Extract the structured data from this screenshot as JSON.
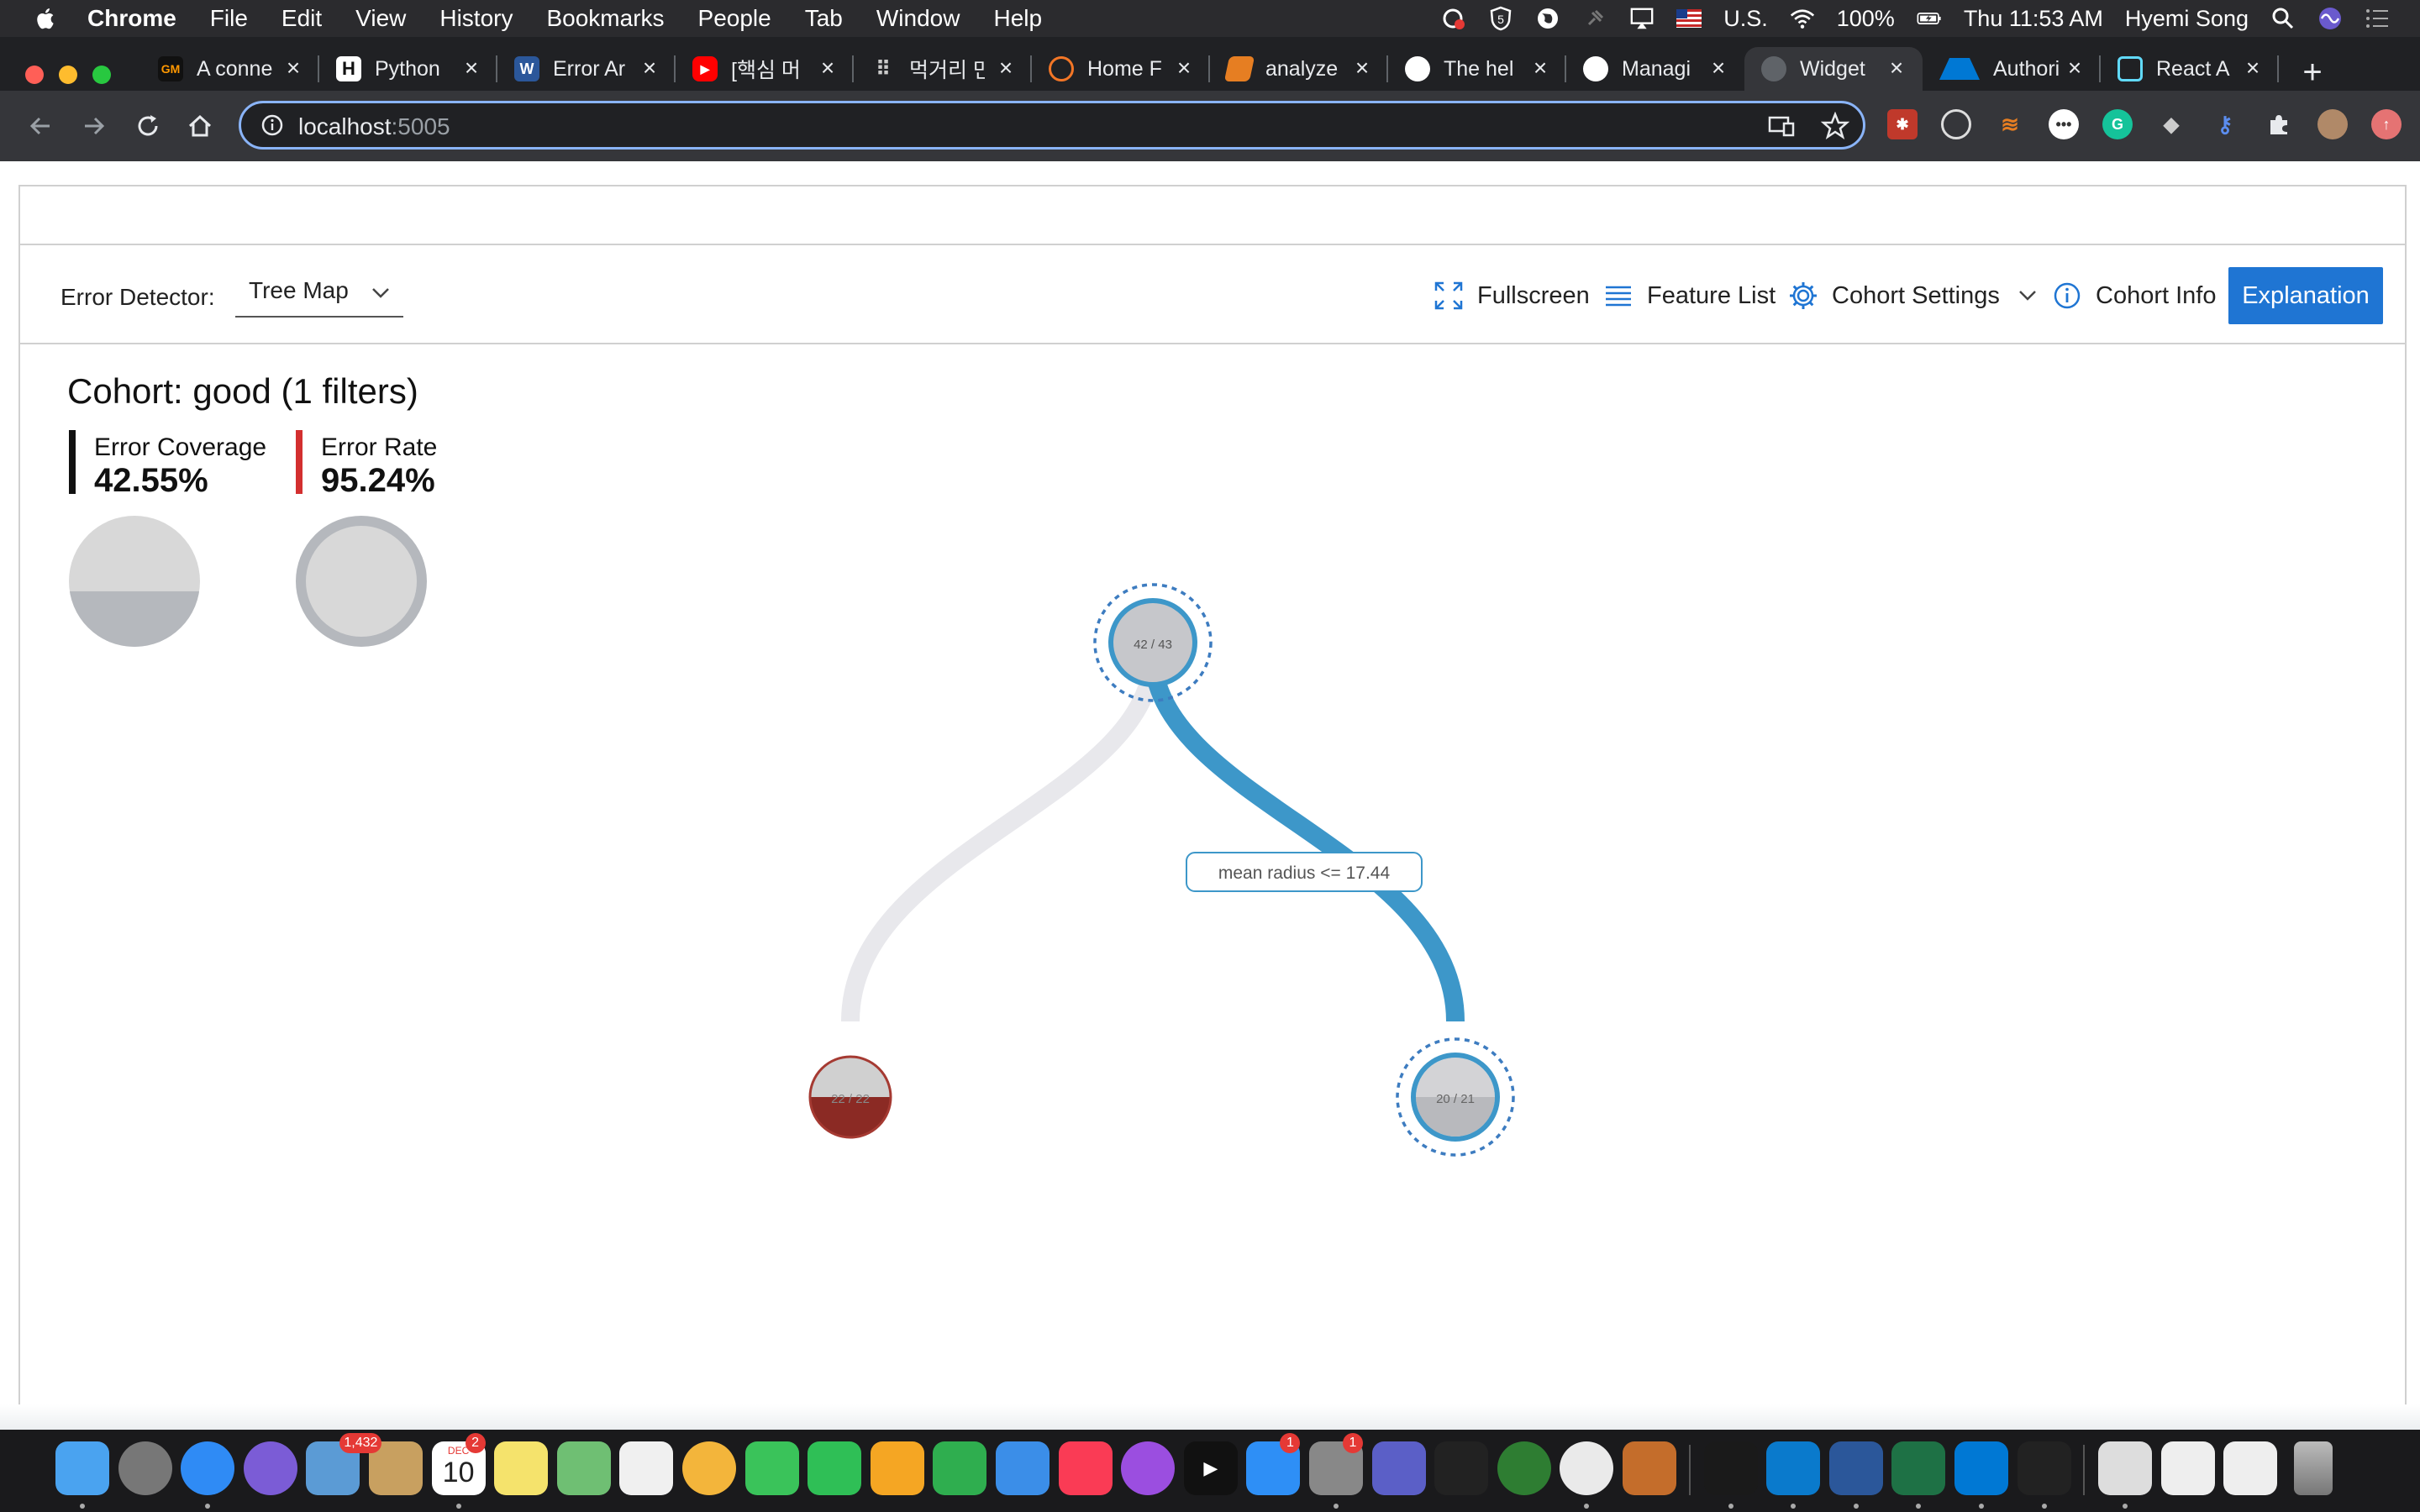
{
  "menubar": {
    "app": "Chrome",
    "items": [
      "File",
      "Edit",
      "View",
      "History",
      "Bookmarks",
      "People",
      "Tab",
      "Window",
      "Help"
    ],
    "status": {
      "input_source": "U.S.",
      "battery": "100%",
      "datetime": "Thu 11:53 AM",
      "user": "Hyemi Song"
    }
  },
  "tabs": [
    {
      "label": "A conne",
      "icon": "gm-icon",
      "color": "#ff9800"
    },
    {
      "label": "Python",
      "icon": "h-icon",
      "color": "#111111"
    },
    {
      "label": "Error Ar",
      "icon": "word-icon",
      "color": "#2b579a"
    },
    {
      "label": "[핵심 머",
      "icon": "youtube-icon",
      "color": "#ff0000"
    },
    {
      "label": "먹거리 만",
      "icon": "dots-icon",
      "color": "#333333"
    },
    {
      "label": "Home F",
      "icon": "jupyter-icon",
      "color": "#f37626"
    },
    {
      "label": "analyze",
      "icon": "book-icon",
      "color": "#e67e22"
    },
    {
      "label": "The hel",
      "icon": "github-icon",
      "color": "#ffffff"
    },
    {
      "label": "Managi",
      "icon": "github-icon",
      "color": "#ffffff"
    },
    {
      "label": "Widget",
      "icon": "globe-icon",
      "color": "#5f6368",
      "active": true
    },
    {
      "label": "Authori",
      "icon": "azure-ml-icon",
      "color": "#0078d4"
    },
    {
      "label": "React A",
      "icon": "react-icon",
      "color": "#61dafb"
    }
  ],
  "address": {
    "host": "localhost",
    "port": ":5005"
  },
  "toolbar": {
    "error_detector_label": "Error Detector:",
    "detector_value": "Tree Map",
    "fullscreen": "Fullscreen",
    "feature_list": "Feature List",
    "cohort_settings": "Cohort Settings",
    "cohort_info": "Cohort Info",
    "explanation": "Explanation"
  },
  "cohort": {
    "title": "Cohort: good (1 filters)",
    "error_coverage_label": "Error Coverage",
    "error_coverage_value": "42.55%",
    "error_coverage_fraction": 0.4255,
    "error_rate_label": "Error Rate",
    "error_rate_value": "95.24%",
    "error_rate_fraction": 0.9524
  },
  "tree": {
    "root": {
      "label": "42 / 43",
      "errors": 42,
      "total": 43,
      "selected": true
    },
    "split_label": "mean radius <= 17.44",
    "left": {
      "label": "22 / 22",
      "errors": 22,
      "total": 22,
      "selected": false
    },
    "right": {
      "label": "20 / 21",
      "errors": 20,
      "total": 21,
      "selected": true
    }
  },
  "colors": {
    "accent": "#1f75d3",
    "selected_path": "#3d97c9",
    "error_node": "#8b2a24",
    "coverage_bar": "#111111",
    "rate_bar": "#d32f2f"
  },
  "dock": {
    "badges": {
      "mail": "1,432",
      "calendar": "2",
      "appstore": "1",
      "sysprefs": "1"
    },
    "calendar_day": "10",
    "calendar_month": "DEC"
  }
}
